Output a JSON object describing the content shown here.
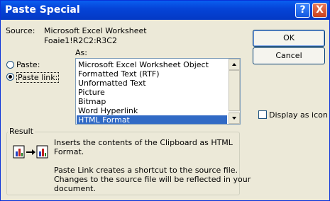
{
  "window": {
    "title": "Paste Special",
    "help_button": "?",
    "close_button": "X"
  },
  "source": {
    "label": "Source:",
    "value_line1": "Microsoft Excel Worksheet",
    "value_line2": "Foaie1!R2C2:R3C2"
  },
  "as_label": "As:",
  "options": {
    "paste_label": "Paste:",
    "paste_link_label": "Paste link:",
    "selected": "Paste link:"
  },
  "formats": [
    "Microsoft Excel Worksheet Object",
    "Formatted Text (RTF)",
    "Unformatted Text",
    "Picture",
    "Bitmap",
    "Word Hyperlink",
    "HTML Format"
  ],
  "selected_format": "HTML Format",
  "buttons": {
    "ok": "OK",
    "cancel": "Cancel"
  },
  "display_as_icon": {
    "label": "Display as icon",
    "checked": false
  },
  "result": {
    "title": "Result",
    "line1": "Inserts the contents of the Clipboard as HTML",
    "line2": "Format.",
    "line3": "Paste Link creates a shortcut to the source file.",
    "line4": "Changes to the source file will be reflected in your",
    "line5": "document."
  },
  "icons": {
    "result": "paste-link-icon"
  },
  "colors": {
    "titlebar": "#0544d8",
    "selection": "#316ac5",
    "dialog_bg": "#ece9d8"
  }
}
